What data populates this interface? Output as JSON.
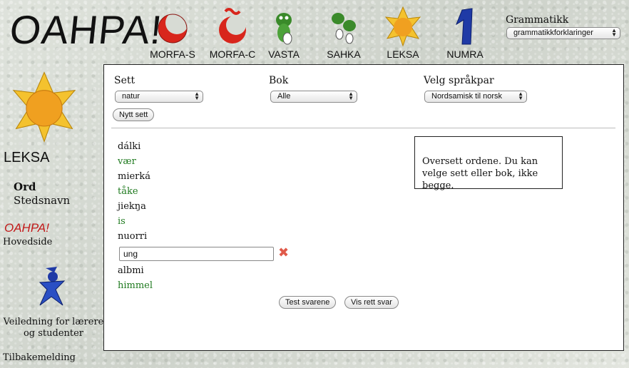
{
  "header": {
    "logo": "OAHPA!",
    "nav": [
      {
        "label": "MORFA-S",
        "icon": "red-moon-icon"
      },
      {
        "label": "MORFA-C",
        "icon": "red-moon-tilde-icon"
      },
      {
        "label": "VASTA",
        "icon": "green-frog-icon"
      },
      {
        "label": "SAHKA",
        "icon": "green-frog-walking-icon"
      },
      {
        "label": "LEKSA",
        "icon": "sun-icon"
      },
      {
        "label": "NUMRA",
        "icon": "blue-numeral-icon"
      }
    ],
    "grammar_label": "Grammatikk",
    "grammar_select": "grammatikkforklaringer"
  },
  "sidebar": {
    "title": "LEKSA",
    "ord": "Ord",
    "stedsnavn": "Stedsnavn",
    "oahpa_logo": "OAHPA!",
    "hovedside": "Hovedside",
    "guide": "Veiledning for lærere og studenter",
    "feedback": "Tilbakemelding"
  },
  "form": {
    "sett_label": "Sett",
    "sett_value": "natur",
    "bok_label": "Bok",
    "bok_value": "Alle",
    "pair_label": "Velg språkpar",
    "pair_value": "Nordsamisk til norsk",
    "new_set_button": "Nytt sett"
  },
  "words": [
    {
      "sami": "dálki",
      "norsk": "vær"
    },
    {
      "sami": "mierká",
      "norsk": "tåke"
    },
    {
      "sami": "jiekŋa",
      "norsk": "is"
    },
    {
      "sami": "nuorri",
      "input": "ung"
    },
    {
      "sami": "albmi",
      "norsk": "himmel"
    }
  ],
  "instruction": "Oversett ordene. Du kan velge sett eller bok, ikke begge.",
  "buttons": {
    "test": "Test svarene",
    "show": "Vis rett svar"
  },
  "colors": {
    "correct": "#1f7a1f",
    "wrong_mark": "#e05a4a",
    "oahpa_red": "#c21a1a"
  }
}
